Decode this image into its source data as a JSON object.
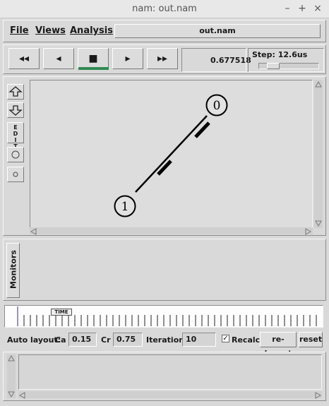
{
  "window": {
    "title": "nam: out.nam"
  },
  "window_controls": {
    "minimize": "–",
    "maximize": "+",
    "close": "×"
  },
  "menu": {
    "file": "File",
    "views": "Views",
    "analysis": "Analysis"
  },
  "file_name": "out.nam",
  "transport": {
    "rewind": "◂◂",
    "back": "◂",
    "stop": "■",
    "play": "▸",
    "fast_forward": "▸▸"
  },
  "time_value": "0.677518",
  "step_label": "Step: 12.6us",
  "tools": {
    "edit_label": "E\nD\nI\nT"
  },
  "nodes": [
    {
      "id": "0"
    },
    {
      "id": "1"
    }
  ],
  "monitors_label": "Monitors",
  "timeline": {
    "time_label": "TIME"
  },
  "auto_layout": {
    "label": "Auto layout:",
    "ca_label": "Ca",
    "ca_value": "0.15",
    "cr_label": "Cr",
    "cr_value": "0.75",
    "iterations_label": "Iterations",
    "iterations_value": "10",
    "recalc_label": "Recalc",
    "recalc_checked": true,
    "relayout_button": "re-layout",
    "reset_button": "reset"
  }
}
